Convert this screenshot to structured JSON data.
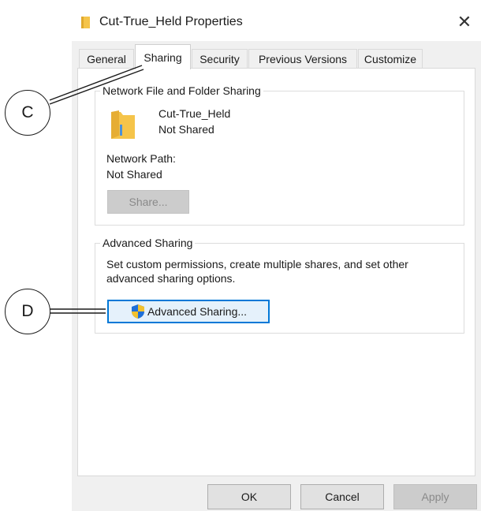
{
  "window": {
    "title": "Cut-True_Held Properties",
    "close_icon": "close-icon"
  },
  "tabs": [
    {
      "label": "General",
      "active": false
    },
    {
      "label": "Sharing",
      "active": true
    },
    {
      "label": "Security",
      "active": false
    },
    {
      "label": "Previous Versions",
      "active": false
    },
    {
      "label": "Customize",
      "active": false
    }
  ],
  "network_sharing": {
    "group_label": "Network File and Folder Sharing",
    "folder_name": "Cut-True_Held",
    "share_status": "Not Shared",
    "network_path_label": "Network Path:",
    "network_path_value": "Not Shared",
    "share_button_label": "Share..."
  },
  "advanced_sharing": {
    "group_label": "Advanced Sharing",
    "description_line1": "Set custom permissions, create multiple shares, and set other",
    "description_line2": "advanced sharing options.",
    "button_label": "Advanced Sharing...",
    "button_icon": "uac-shield-icon"
  },
  "footer": {
    "ok_label": "OK",
    "cancel_label": "Cancel",
    "apply_label": "Apply"
  },
  "callouts": {
    "c_label": "C",
    "d_label": "D"
  },
  "colors": {
    "accent": "#0078d7",
    "folder": "#f5c44a",
    "dialog_bg": "#f0f0f0"
  }
}
